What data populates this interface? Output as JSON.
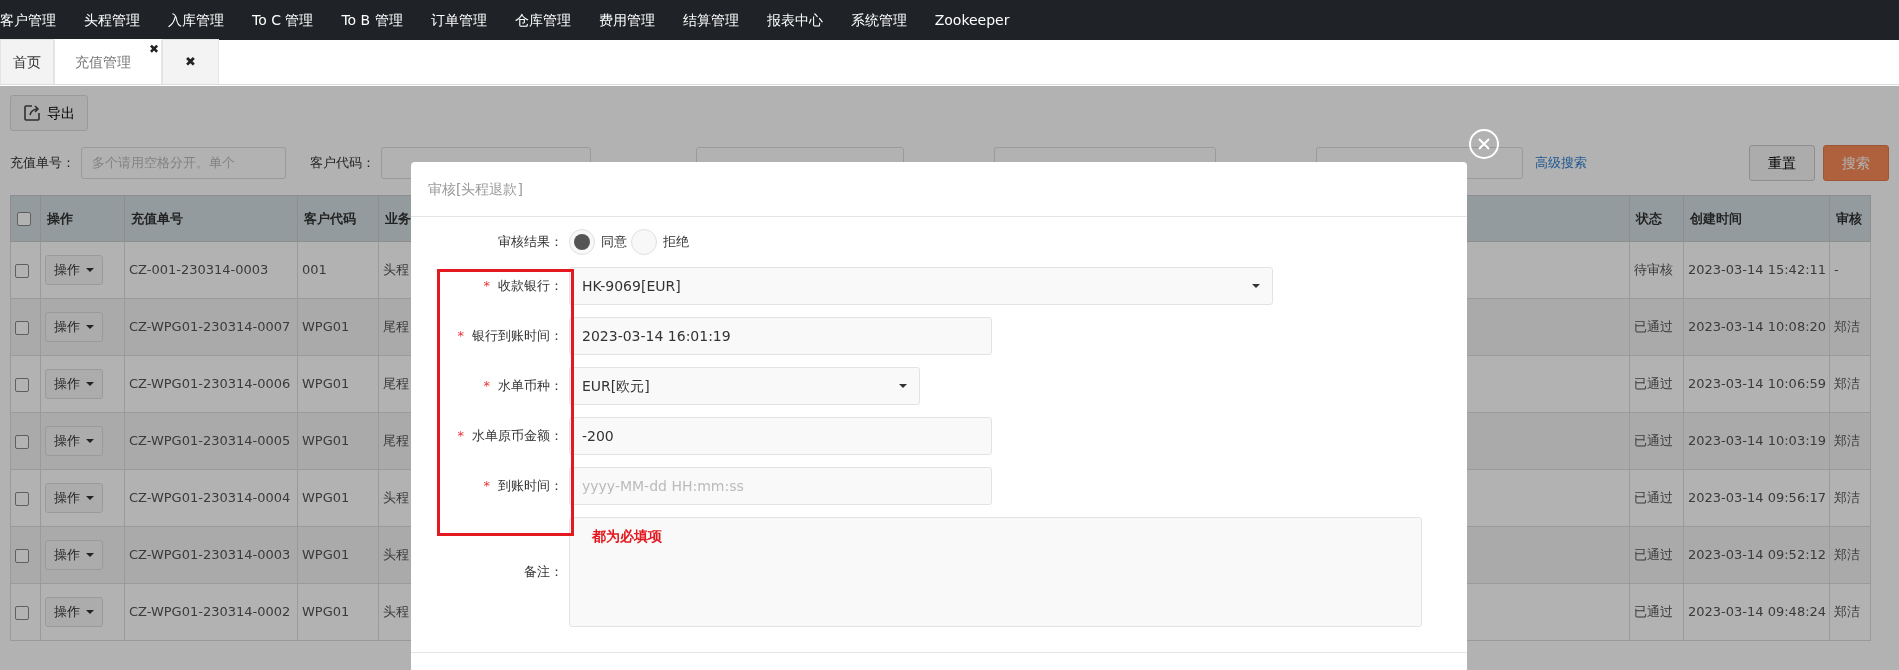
{
  "nav": {
    "items": [
      {
        "label": "客户管理"
      },
      {
        "label": "头程管理"
      },
      {
        "label": "入库管理"
      },
      {
        "label": "To C 管理"
      },
      {
        "label": "To B 管理"
      },
      {
        "label": "订单管理"
      },
      {
        "label": "仓库管理"
      },
      {
        "label": "费用管理"
      },
      {
        "label": "结算管理"
      },
      {
        "label": "报表中心"
      },
      {
        "label": "系统管理"
      },
      {
        "label": "Zookeeper"
      }
    ]
  },
  "tabs": [
    {
      "kind": "page",
      "label": "首页",
      "selected": false
    },
    {
      "kind": "page",
      "label": "充值管理",
      "selected": true,
      "close": "✖"
    },
    {
      "kind": "close-all",
      "label": "✖"
    }
  ],
  "toolbar": {
    "export": "导出"
  },
  "filters": [
    {
      "label": "充值单号：",
      "placeholder": "多个请用空格分开。单个"
    },
    {
      "label": "客户代码："
    }
  ],
  "advanced_search": "高级搜索",
  "buttons": {
    "reset": "重置",
    "search": "搜索"
  },
  "table": {
    "all_checked": false,
    "columns": [
      "操作",
      "充值单号",
      "客户代码",
      "业务",
      "状态",
      "创建时间",
      "审核"
    ],
    "rows": [
      {
        "checked": false,
        "cells": [
          "操作",
          "CZ-001-230314-0003",
          "001",
          "头程",
          "待审核",
          "2023-03-14 15:42:11",
          "-"
        ]
      },
      {
        "checked": false,
        "cells": [
          "操作",
          "CZ-WPG01-230314-0007",
          "WPG01",
          "尾程",
          "已通过",
          "2023-03-14 10:08:20",
          "郑洁"
        ]
      },
      {
        "checked": false,
        "cells": [
          "操作",
          "CZ-WPG01-230314-0006",
          "WPG01",
          "尾程",
          "已通过",
          "2023-03-14 10:06:59",
          "郑洁"
        ]
      },
      {
        "checked": false,
        "cells": [
          "操作",
          "CZ-WPG01-230314-0005",
          "WPG01",
          "尾程",
          "已通过",
          "2023-03-14 10:03:19",
          "郑洁"
        ]
      },
      {
        "checked": false,
        "cells": [
          "操作",
          "CZ-WPG01-230314-0004",
          "WPG01",
          "头程",
          "已通过",
          "2023-03-14 09:56:17",
          "郑洁"
        ]
      },
      {
        "checked": false,
        "cells": [
          "操作",
          "CZ-WPG01-230314-0003",
          "WPG01",
          "头程",
          "已通过",
          "2023-03-14 09:52:12",
          "郑洁"
        ]
      },
      {
        "checked": false,
        "cells": [
          "操作",
          "CZ-WPG01-230314-0002",
          "WPG01",
          "头程",
          "已通过",
          "2023-03-14 09:48:24",
          "郑洁"
        ]
      }
    ]
  },
  "modal": {
    "title": "审核[头程退款]",
    "result": {
      "label": "审核结果：",
      "options": [
        {
          "label": "同意",
          "selected": true
        },
        {
          "label": "拒绝",
          "selected": false
        }
      ]
    },
    "fields": [
      {
        "kind": "select",
        "asterisk": "*",
        "label": "收款银行：",
        "value": "HK-9069[EUR]"
      },
      {
        "kind": "input",
        "asterisk": "*",
        "label": "银行到账时间：",
        "value": "2023-03-14 16:01:19"
      },
      {
        "kind": "select",
        "asterisk": "*",
        "label": "水单币种：",
        "value": "EUR[欧元]"
      },
      {
        "kind": "input",
        "asterisk": "*",
        "label": "水单原币金额：",
        "value": "-200"
      },
      {
        "kind": "input",
        "asterisk": "*",
        "label": "到账时间：",
        "placeholder": "yyyy-MM-dd HH:mm:ss"
      }
    ],
    "remark": {
      "label": "备注：",
      "annotation": "都为必填项"
    }
  }
}
